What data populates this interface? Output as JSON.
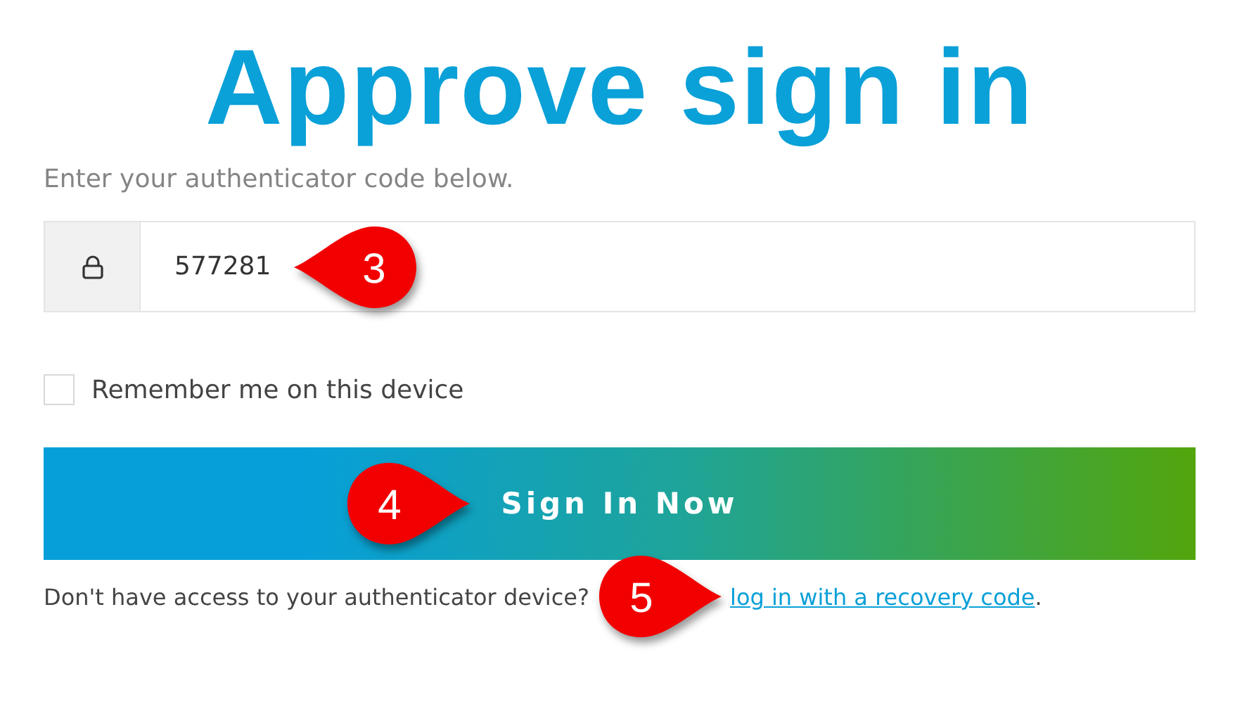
{
  "title": "Approve sign in",
  "subtitle": "Enter your authenticator code below.",
  "code_field": {
    "value": "577281",
    "callout": {
      "label": "3",
      "kind": "tip-left"
    }
  },
  "remember": {
    "label": "Remember me on this device",
    "checked": false
  },
  "submit": {
    "label": "Sign In Now",
    "callout": {
      "label": "4",
      "kind": "tip-right"
    }
  },
  "footer": {
    "text": "Don't have access to your authenticator device?",
    "link": "log in with a recovery code",
    "end": ".",
    "callout": {
      "label": "5",
      "kind": "tip-right"
    }
  }
}
